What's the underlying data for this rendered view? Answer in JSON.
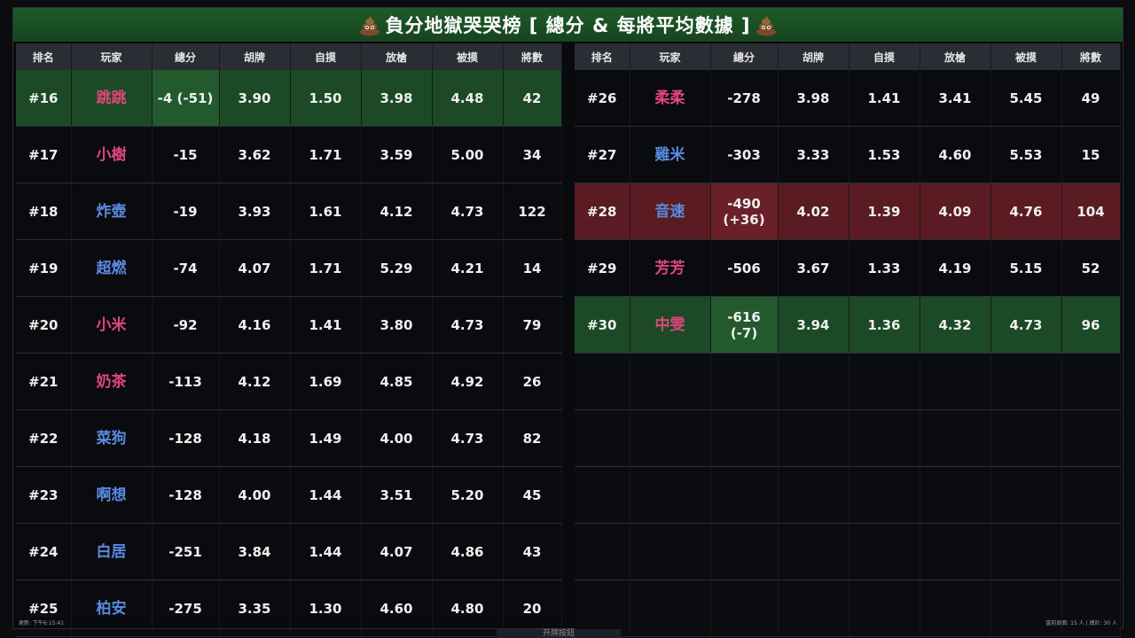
{
  "title": "負分地獄哭哭榜 [ 總分 & 每將平均數據 ]",
  "columns": [
    "排名",
    "玩家",
    "總分",
    "胡牌",
    "自摸",
    "放槍",
    "被摸",
    "將數"
  ],
  "left_rows": [
    {
      "rank": "#16",
      "name": "跳跳",
      "color": "pink",
      "total": "-4 (-51)",
      "hu": "3.90",
      "zimo": "1.50",
      "fangqiang": "3.98",
      "beimo": "4.48",
      "games": "42",
      "highlight": "green"
    },
    {
      "rank": "#17",
      "name": "小樹",
      "color": "pink",
      "total": "-15",
      "hu": "3.62",
      "zimo": "1.71",
      "fangqiang": "3.59",
      "beimo": "5.00",
      "games": "34",
      "highlight": ""
    },
    {
      "rank": "#18",
      "name": "炸壺",
      "color": "blue",
      "total": "-19",
      "hu": "3.93",
      "zimo": "1.61",
      "fangqiang": "4.12",
      "beimo": "4.73",
      "games": "122",
      "highlight": ""
    },
    {
      "rank": "#19",
      "name": "超燃",
      "color": "blue",
      "total": "-74",
      "hu": "4.07",
      "zimo": "1.71",
      "fangqiang": "5.29",
      "beimo": "4.21",
      "games": "14",
      "highlight": ""
    },
    {
      "rank": "#20",
      "name": "小米",
      "color": "pink",
      "total": "-92",
      "hu": "4.16",
      "zimo": "1.41",
      "fangqiang": "3.80",
      "beimo": "4.73",
      "games": "79",
      "highlight": ""
    },
    {
      "rank": "#21",
      "name": "奶茶",
      "color": "pink",
      "total": "-113",
      "hu": "4.12",
      "zimo": "1.69",
      "fangqiang": "4.85",
      "beimo": "4.92",
      "games": "26",
      "highlight": ""
    },
    {
      "rank": "#22",
      "name": "菜狗",
      "color": "blue",
      "total": "-128",
      "hu": "4.18",
      "zimo": "1.49",
      "fangqiang": "4.00",
      "beimo": "4.73",
      "games": "82",
      "highlight": ""
    },
    {
      "rank": "#23",
      "name": "啊想",
      "color": "blue",
      "total": "-128",
      "hu": "4.00",
      "zimo": "1.44",
      "fangqiang": "3.51",
      "beimo": "5.20",
      "games": "45",
      "highlight": ""
    },
    {
      "rank": "#24",
      "name": "白居",
      "color": "blue",
      "total": "-251",
      "hu": "3.84",
      "zimo": "1.44",
      "fangqiang": "4.07",
      "beimo": "4.86",
      "games": "43",
      "highlight": ""
    },
    {
      "rank": "#25",
      "name": "柏安",
      "color": "blue",
      "total": "-275",
      "hu": "3.35",
      "zimo": "1.30",
      "fangqiang": "4.60",
      "beimo": "4.80",
      "games": "20",
      "highlight": ""
    }
  ],
  "right_rows": [
    {
      "rank": "#26",
      "name": "柔柔",
      "color": "pink",
      "total": "-278",
      "hu": "3.98",
      "zimo": "1.41",
      "fangqiang": "3.41",
      "beimo": "5.45",
      "games": "49",
      "highlight": ""
    },
    {
      "rank": "#27",
      "name": "雞米",
      "color": "blue",
      "total": "-303",
      "hu": "3.33",
      "zimo": "1.53",
      "fangqiang": "4.60",
      "beimo": "5.53",
      "games": "15",
      "highlight": ""
    },
    {
      "rank": "#28",
      "name": "音速",
      "color": "blue",
      "total": "-490\n(+36)",
      "hu": "4.02",
      "zimo": "1.39",
      "fangqiang": "4.09",
      "beimo": "4.76",
      "games": "104",
      "highlight": "red"
    },
    {
      "rank": "#29",
      "name": "芳芳",
      "color": "pink",
      "total": "-506",
      "hu": "3.67",
      "zimo": "1.33",
      "fangqiang": "4.19",
      "beimo": "5.15",
      "games": "52",
      "highlight": ""
    },
    {
      "rank": "#30",
      "name": "中雯",
      "color": "pink",
      "total": "-616\n(-7)",
      "hu": "3.94",
      "zimo": "1.36",
      "fangqiang": "4.32",
      "beimo": "4.73",
      "games": "96",
      "highlight": "green"
    }
  ],
  "right_empty_rows": 5,
  "footer": {
    "updated": "更新: 下午6:15:41",
    "count": "當前頁面: 15 人 | 總計: 30 人"
  },
  "under_tab": "开牌按鈕",
  "colors": {
    "pink": "#e0457e",
    "blue": "#5a8be0",
    "green_row": "#1d4a26",
    "red_row": "#5a1c22"
  }
}
